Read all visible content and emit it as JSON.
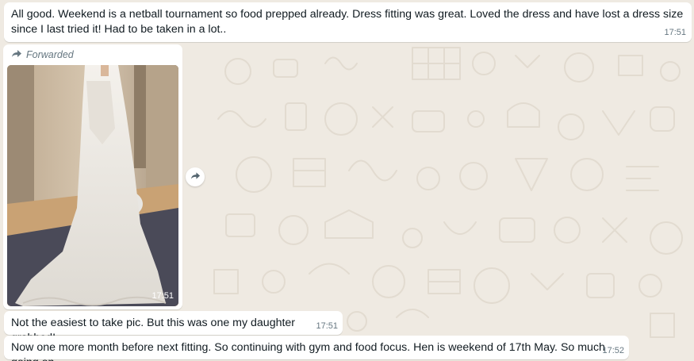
{
  "messages": [
    {
      "text": "All good. Weekend is a netball tournament so food prepped already. Dress fitting was great. Loved the dress and have lost a dress size since I last tried it! Had to be taken in a lot..",
      "time": "17:51"
    },
    {
      "forwarded_label": "Forwarded",
      "image_subject": "wedding dress fitting photo",
      "time": "17:51"
    },
    {
      "text": "Not the easiest to take pic. But this was one my daughter grabbed!",
      "time": "17:51"
    },
    {
      "text": "Now one more month before next fitting. So continuing with gym and food focus. Hen is weekend of 17th May. So much going on.",
      "time": "17:52"
    }
  ],
  "icons": {
    "forwarded": "forward-arrow-icon",
    "share": "share-forward-icon"
  },
  "colors": {
    "chat_background": "#efeae2",
    "bubble": "#ffffff",
    "meta_text": "#667781"
  }
}
